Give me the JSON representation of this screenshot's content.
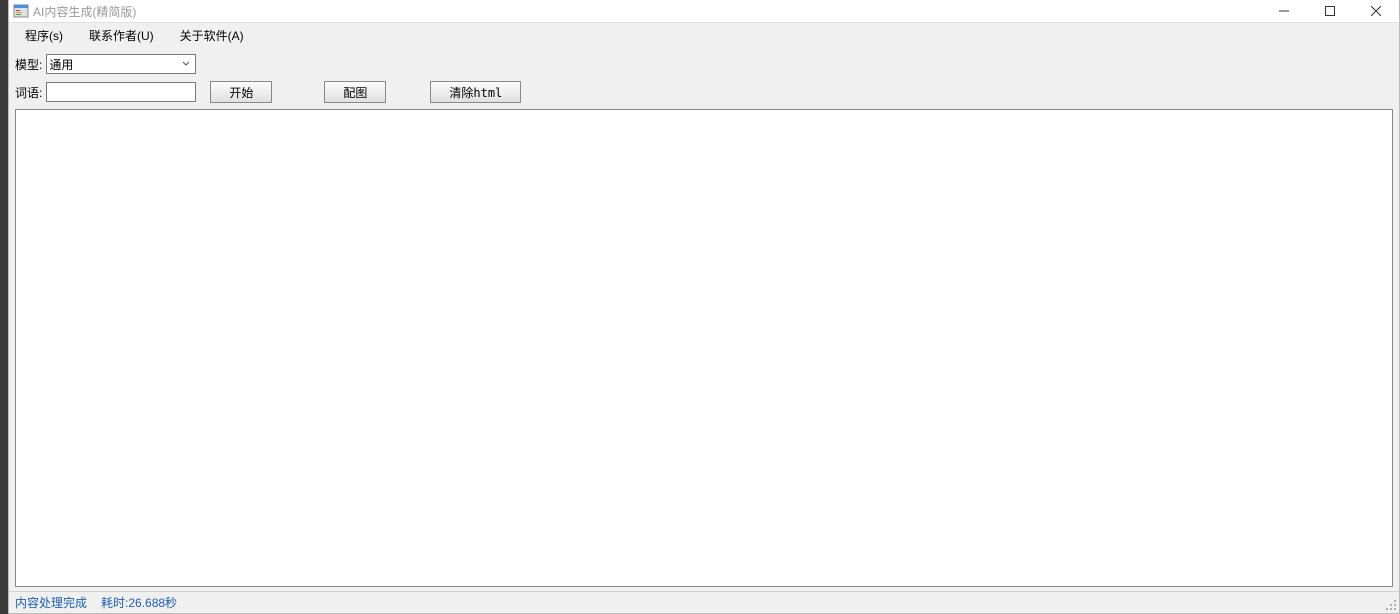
{
  "window": {
    "title": "AI内容生成(精简版)"
  },
  "menu": {
    "program": "程序(s)",
    "contact": "联系作者(U)",
    "about": "关于软件(A)"
  },
  "toolbar": {
    "model_label": "模型:",
    "model_value": "通用",
    "word_label": "词语:",
    "word_value": "",
    "start_label": "开始",
    "image_label": "配图",
    "clear_label": "清除html"
  },
  "status": {
    "done": "内容处理完成",
    "time": "耗时:26.688秒"
  }
}
